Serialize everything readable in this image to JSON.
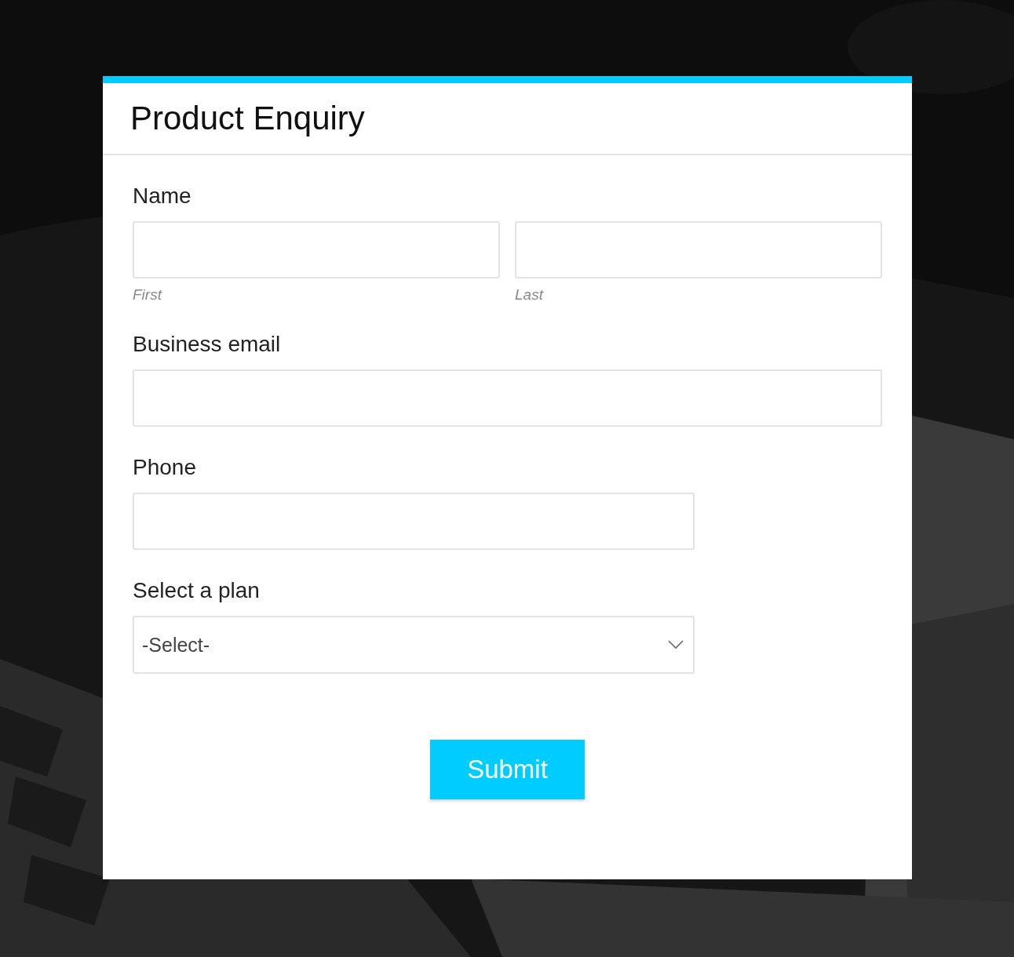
{
  "form": {
    "title": "Product Enquiry",
    "fields": [
      {
        "kind": "split",
        "label": "Name",
        "parts": [
          {
            "sublabel": "First"
          },
          {
            "sublabel": "Last"
          }
        ]
      },
      {
        "kind": "wide",
        "label": "Business email"
      },
      {
        "kind": "narrow",
        "label": "Phone"
      },
      {
        "kind": "select",
        "label": "Select a plan",
        "value": "-Select-"
      }
    ],
    "submit": "Submit"
  }
}
